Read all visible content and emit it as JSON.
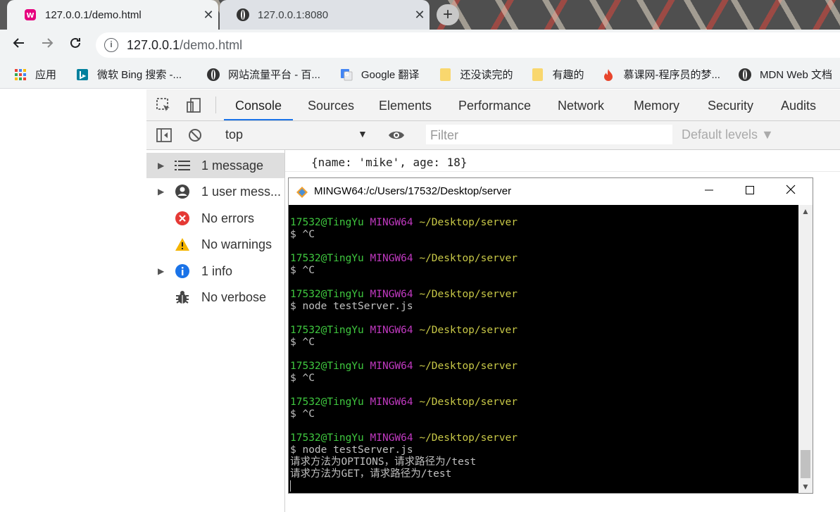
{
  "browser": {
    "tabs": [
      {
        "title": "127.0.0.1/demo.html",
        "active": true
      },
      {
        "title": "127.0.0.1:8080",
        "active": false
      }
    ],
    "new_tab": "+",
    "close_glyph": "✕",
    "address": {
      "host": "127.0.0.1",
      "path": "/demo.html",
      "info_glyph": "i"
    },
    "bookmarks": [
      {
        "label": "应用",
        "icon": "apps-grid-icon"
      },
      {
        "label": "微软 Bing 搜索 -...",
        "icon": "bing-icon"
      },
      {
        "label": "网站流量平台 - 百...",
        "icon": "globe-icon"
      },
      {
        "label": "Google 翻译",
        "icon": "translate-icon"
      },
      {
        "label": "还没读完的",
        "icon": "folder-icon"
      },
      {
        "label": "有趣的",
        "icon": "folder-icon"
      },
      {
        "label": "慕课网-程序员的梦...",
        "icon": "fire-icon"
      },
      {
        "label": "MDN Web 文档",
        "icon": "globe-icon"
      }
    ]
  },
  "devtools": {
    "tabs": [
      "Console",
      "Sources",
      "Elements",
      "Performance",
      "Network",
      "Memory",
      "Security",
      "Audits"
    ],
    "active_tab": "Console",
    "context": "top",
    "filter_placeholder": "Filter",
    "levels": "Default levels ▼",
    "sidebar": [
      {
        "label": "1 message",
        "expandable": true,
        "icon": "list-icon"
      },
      {
        "label": "1 user mess...",
        "expandable": true,
        "icon": "user-icon"
      },
      {
        "label": "No errors",
        "expandable": false,
        "icon": "error-icon"
      },
      {
        "label": "No warnings",
        "expandable": false,
        "icon": "warning-icon"
      },
      {
        "label": "1 info",
        "expandable": true,
        "icon": "info-icon"
      },
      {
        "label": "No verbose",
        "expandable": false,
        "icon": "bug-icon"
      }
    ],
    "console_output": "{name: 'mike', age: 18}"
  },
  "terminal": {
    "title": "MINGW64:/c/Users/17532/Desktop/server",
    "prompt": {
      "user": "17532@TingYu",
      "system": "MINGW64",
      "path": "~/Desktop/server"
    },
    "commands": [
      "$ ^C",
      "$ ^C",
      "$ node testServer.js",
      "$ ^C",
      "$ ^C",
      "$ ^C",
      "$ node testServer.js"
    ],
    "output": [
      "请求方法为OPTIONS，请求路径为/test",
      "请求方法为GET，请求路径为/test"
    ]
  },
  "colors": {
    "prompt_user": "#3fc83f",
    "prompt_system": "#c039c0",
    "prompt_path": "#c8c847",
    "devtools_accent": "#1a73e8",
    "error": "#e53935",
    "warning": "#f4b400",
    "info": "#1a73e8"
  }
}
